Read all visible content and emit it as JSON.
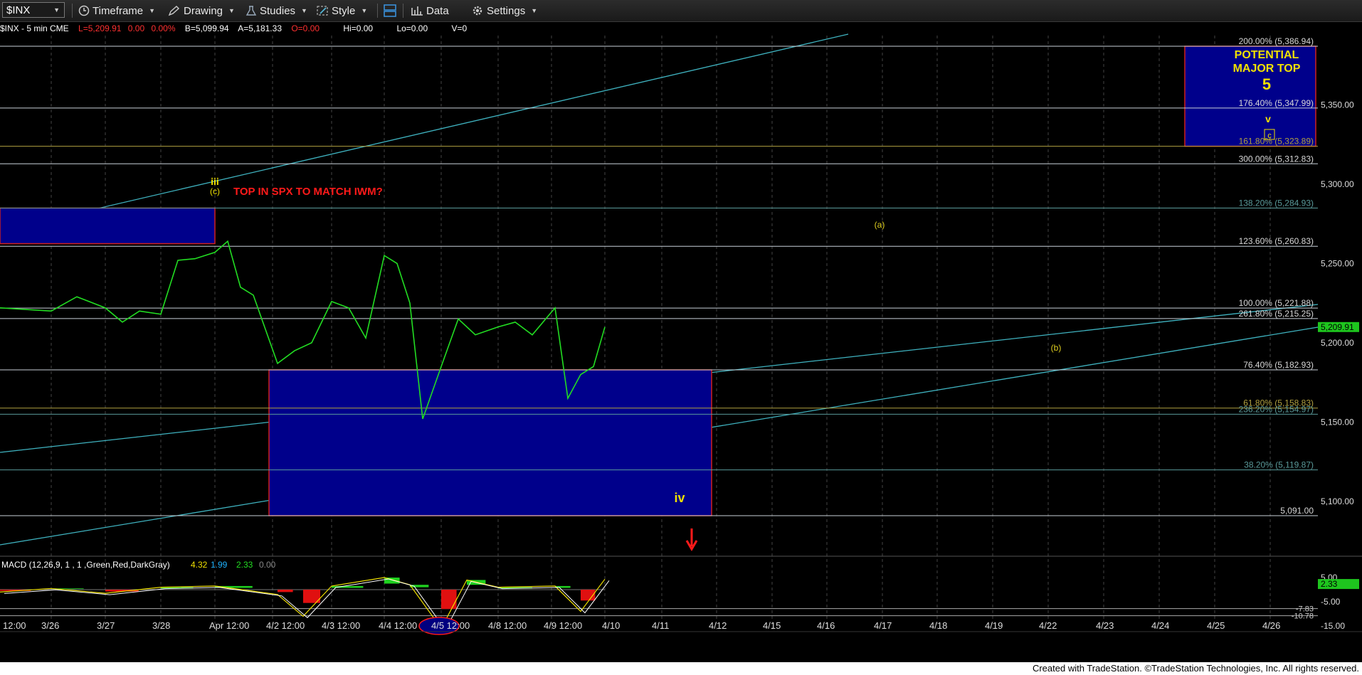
{
  "toolbar": {
    "symbol": "$INX",
    "timeframe": "Timeframe",
    "drawing": "Drawing",
    "studies": "Studies",
    "style": "Style",
    "data": "Data",
    "settings": "Settings"
  },
  "info": {
    "symbol_desc": "$INX - 5 min  CME",
    "last": "L=5,209.91",
    "net": "0.00",
    "pct": "0.00%",
    "b": "B=5,099.94",
    "a": "A=5,181.33",
    "o": "O=0.00",
    "hi": "Hi=0.00",
    "lo": "Lo=0.00",
    "v": "V=0"
  },
  "colors": {
    "price": "#22dd22",
    "up_bar": "#1fd01f",
    "down_bar": "#e01010",
    "fib_line": "#c8d0d8",
    "trend": "#3fb3c0",
    "box_fill": "#00008b",
    "box_border": "#d02020",
    "label_yellow": "#f0e000",
    "label_red": "#ff1a1a"
  },
  "chart_data": {
    "type": "line",
    "title": "$INX - 5 min  CME",
    "ylim": [
      5058,
      5410
    ],
    "x_tick_labels": [
      "12:00",
      "3/26",
      "3/27",
      "3/28",
      "Apr 12:00",
      "4/2 12:00",
      "4/3 12:00",
      "4/4 12:00",
      "4/5 12:00",
      "4/8 12:00",
      "4/9 12:00",
      "4/10",
      "4/11",
      "4/12",
      "4/15",
      "4/16",
      "4/17",
      "4/18",
      "4/19",
      "4/22",
      "4/23",
      "4/24",
      "4/25",
      "4/26"
    ],
    "y_tick_labels": [
      "5,350.00",
      "5,300.00",
      "5,250.00",
      "5,200.00",
      "5,150.00",
      "5,100.00"
    ],
    "y_ticks": [
      5350,
      5300,
      5250,
      5200,
      5150,
      5100
    ],
    "last_price": "5,209.91",
    "last_price_value": 5209.91,
    "series": [
      {
        "x": [
          "3/25",
          "3/26",
          "3/26",
          "3/27",
          "3/27",
          "3/27",
          "3/28",
          "3/28",
          "3/28",
          "4/1",
          "4/1",
          "4/1",
          "4/1",
          "4/2",
          "4/2",
          "4/2",
          "4/3",
          "4/3",
          "4/3",
          "4/4",
          "4/4",
          "4/4",
          "4/4",
          "4/5",
          "4/5",
          "4/5",
          "4/8",
          "4/8",
          "4/8",
          "4/9",
          "4/9",
          "4/9",
          "4/9",
          "4/10"
        ],
        "values": [
          5222,
          5220,
          5229,
          5222,
          5213,
          5220,
          5218,
          5252,
          5253,
          5257,
          5264,
          5235,
          5230,
          5187,
          5195,
          5200,
          5226,
          5222,
          5203,
          5255,
          5250,
          5225,
          5152,
          5185,
          5215,
          5205,
          5210,
          5213,
          5205,
          5222,
          5165,
          5180,
          5185,
          5209.91
        ]
      }
    ],
    "fib_levels": [
      {
        "label": "200.00% (5,386.94)",
        "value": 5386.94
      },
      {
        "label": "176.40% (5,347.99)",
        "value": 5347.99
      },
      {
        "label": "161.80% (5,323.89)",
        "value": 5323.89
      },
      {
        "label": "300.00% (5,312.83)",
        "value": 5312.83
      },
      {
        "label": "138.20% (5,284.93)",
        "value": 5284.93
      },
      {
        "label": "123.60% (5,260.83)",
        "value": 5260.83
      },
      {
        "label": "100.00% (5,221.88)",
        "value": 5221.88
      },
      {
        "label": "261.80% (5,215.25)",
        "value": 5215.25
      },
      {
        "label": "76.40% (5,182.93)",
        "value": 5182.93
      },
      {
        "label": "61.80% (5,158.83)",
        "value": 5158.83
      },
      {
        "label": "236.20% (5,154.97)",
        "value": 5154.97
      },
      {
        "label": "38.20% (5,119.87)",
        "value": 5119.87
      },
      {
        "label": "5,091.00",
        "value": 5091.0
      }
    ],
    "zones": [
      {
        "name": "major-top",
        "y_from": 5386.94,
        "y_to": 5323.89
      },
      {
        "name": "wave-iii",
        "y_from": 5284.93,
        "y_to": 5262.5
      },
      {
        "name": "wave-iv",
        "y_from": 5182.93,
        "y_to": 5091.0
      }
    ],
    "annotations": {
      "potential_top_line1": "POTENTIAL",
      "potential_top_line2": "MAJOR TOP",
      "potential_top_num": "5",
      "wave_v": "v",
      "wave_c_box": "c",
      "wave_iii": "iii",
      "wave_c": "(c)",
      "question": "TOP IN SPX TO MATCH IWM?",
      "wave_a": "(a)",
      "wave_b": "(b)",
      "wave_iv": "iv"
    },
    "macd": {
      "label": "MACD (12,26,9, 1 , 1 ,Green,Red,DarkGray)",
      "macd": "4.32",
      "signal": "1.99",
      "hist": "2.33",
      "zero": "0.00",
      "ylim": [
        -17,
        7
      ],
      "axis_labels": [
        "5.00",
        "-5.00",
        "-15.00"
      ],
      "axis_values": [
        5,
        -5,
        -15
      ],
      "ref_labels": [
        "-7.83",
        "-10.78"
      ],
      "ref_values": [
        -7.83,
        -10.78
      ],
      "current": "2.33",
      "current_value": 2.33,
      "x": [
        "3/25",
        "3/26",
        "3/27",
        "3/28",
        "4/1",
        "4/2",
        "4/2",
        "4/3",
        "4/4",
        "4/4",
        "4/5",
        "4/5",
        "4/8",
        "4/9",
        "4/9",
        "4/10"
      ],
      "values": [
        -1,
        0.5,
        -1.5,
        1,
        1.5,
        -2,
        -11,
        1.5,
        5,
        2,
        -16,
        4,
        1,
        1.5,
        -9,
        4.32
      ]
    }
  },
  "footer": "Created with TradeStation. ©TradeStation Technologies, Inc. All rights reserved."
}
